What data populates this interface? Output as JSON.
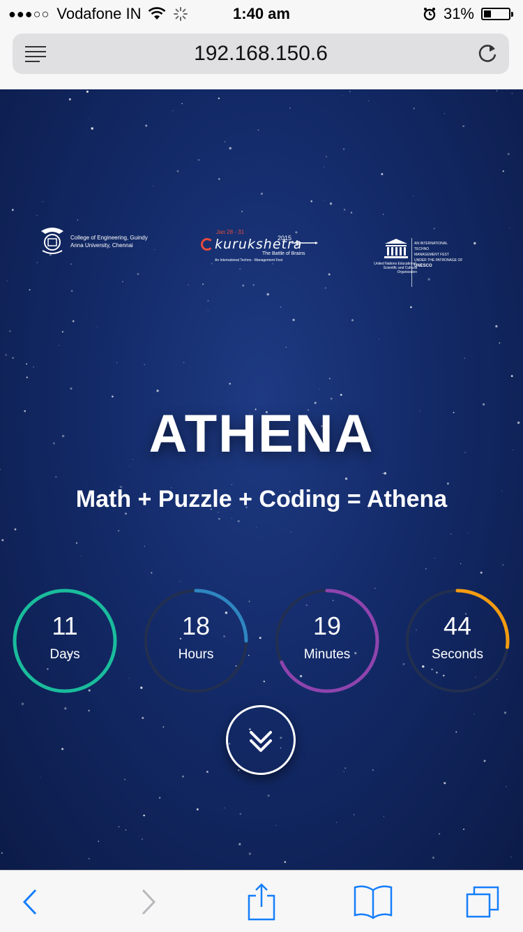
{
  "status_bar": {
    "carrier": "Vodafone IN",
    "signal_dots": "●●●○○",
    "time": "1:40 am",
    "battery": "31%"
  },
  "address_bar": {
    "url": "192.168.150.6"
  },
  "logos": {
    "ceg_line1": "College of Engineering, Guindy",
    "ceg_line2": "Anna University, Chennai",
    "kk_date": "Jan 28 - 31",
    "kk_year": "2015",
    "kk_name": "kurukshetra",
    "kk_tagline": "The Battle of Brains",
    "kk_sub": "An International Techno - Management Fest",
    "un_left": "United Nations Educational, Scientific and Cultural Organization",
    "un_right_1": "AN INTERNATIONAL",
    "un_right_2": "TECHNO",
    "un_right_3": "MANAGEMENT FEST",
    "un_right_4": "UNDER THE PATRONAGE OF",
    "un_right_5": "UNESCO"
  },
  "hero": {
    "title": "ATHENA",
    "tagline": "Math + Puzzle + Coding = Athena"
  },
  "countdown": [
    {
      "value": "11",
      "label": "Days",
      "fraction": 1.0,
      "color": "#1abc9c"
    },
    {
      "value": "18",
      "label": "Hours",
      "fraction": 0.25,
      "color": "#2e86c1"
    },
    {
      "value": "19",
      "label": "Minutes",
      "fraction": 0.68,
      "color": "#8e44ad"
    },
    {
      "value": "44",
      "label": "Seconds",
      "fraction": 0.27,
      "color": "#f39c12"
    }
  ],
  "toolbar": {
    "icons": [
      "back-icon",
      "forward-icon",
      "share-icon",
      "bookmarks-icon",
      "tabs-icon"
    ]
  },
  "colors": {
    "hero_bg": "#132a68",
    "ring_track": "#232f4f",
    "toolbar_blue": "#157efb"
  }
}
